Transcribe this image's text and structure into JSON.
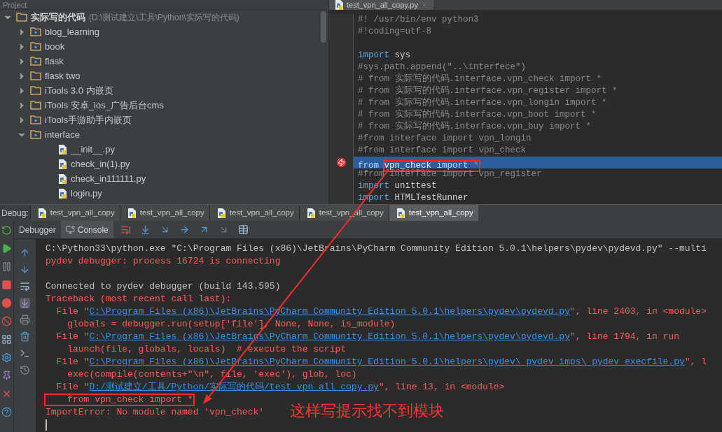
{
  "project_panel": {
    "title": "Project",
    "tree": [
      {
        "kind": "root",
        "name": "实际写的代码",
        "path": "(D:\\测试建立\\工具\\Python\\实际写的代码)",
        "expanded": true,
        "children": [
          {
            "kind": "folder",
            "name": "blog_learning",
            "package": true,
            "expanded": false
          },
          {
            "kind": "folder",
            "name": "book",
            "package": true,
            "expanded": false
          },
          {
            "kind": "folder",
            "name": "flask",
            "package": true,
            "expanded": false
          },
          {
            "kind": "folder",
            "name": "flask two",
            "package": false,
            "expanded": false
          },
          {
            "kind": "folder",
            "name": "iTools 3.0 内嵌页",
            "package": false,
            "expanded": false
          },
          {
            "kind": "folder",
            "name": "iTools 安卓_ios_广告后台cms",
            "package": false,
            "expanded": false
          },
          {
            "kind": "folder",
            "name": "iTools手游助手内嵌页",
            "package": true,
            "expanded": false
          },
          {
            "kind": "folder",
            "name": "interface",
            "package": true,
            "expanded": true,
            "children": [
              {
                "kind": "file",
                "name": "__init__.py"
              },
              {
                "kind": "file",
                "name": "check_in(1).py"
              },
              {
                "kind": "file",
                "name": "check_in111111.py"
              },
              {
                "kind": "file",
                "name": "login.py"
              }
            ]
          }
        ]
      }
    ]
  },
  "editor": {
    "tab": "test_vpn_all_copy.py",
    "lines": [
      {
        "segments": [
          {
            "kind": "comment",
            "text": "#! /usr/bin/env python3"
          }
        ],
        "highlighted": false,
        "breakpoint": false
      },
      {
        "segments": [
          {
            "kind": "comment",
            "text": "#!coding=utf-8"
          }
        ],
        "highlighted": false,
        "breakpoint": false
      },
      {
        "highlighted": false,
        "breakpoint": false
      },
      {
        "segments": [
          {
            "kind": "keyword",
            "text": "import"
          },
          {
            "kind": "plain",
            "text": " sys"
          }
        ],
        "highlighted": false,
        "breakpoint": false
      },
      {
        "segments": [
          {
            "kind": "comment",
            "text": "#sys.path.append(\"..\\interfece\")"
          }
        ],
        "highlighted": false,
        "breakpoint": false
      },
      {
        "segments": [
          {
            "kind": "comment",
            "text": "# from 实际写的代码.interface.vpn_check import *"
          }
        ],
        "highlighted": false,
        "breakpoint": false
      },
      {
        "segments": [
          {
            "kind": "comment",
            "text": "# from 实际写的代码.interface.vpn_register import *"
          }
        ],
        "highlighted": false,
        "breakpoint": false
      },
      {
        "segments": [
          {
            "kind": "comment",
            "text": "# from 实际写的代码.interface.vpn_longin import *"
          }
        ],
        "highlighted": false,
        "breakpoint": false
      },
      {
        "segments": [
          {
            "kind": "comment",
            "text": "# from 实际写的代码.interface.vpn_boot import *"
          }
        ],
        "highlighted": false,
        "breakpoint": false
      },
      {
        "segments": [
          {
            "kind": "comment",
            "text": "# from 实际写的代码.interface.vpn_buy import *"
          }
        ],
        "highlighted": false,
        "breakpoint": false
      },
      {
        "segments": [
          {
            "kind": "comment",
            "text": "#from interface import vpn_longin"
          }
        ],
        "highlighted": false,
        "breakpoint": false
      },
      {
        "segments": [
          {
            "kind": "comment",
            "text": "#from interface import vpn_check"
          }
        ],
        "highlighted": false,
        "breakpoint": false
      },
      {
        "segments": [
          {
            "kind": "keyword",
            "text": "from ",
            "boxed": false
          },
          {
            "kind": "unresolved",
            "text": "vpn_check",
            "boxed": true
          },
          {
            "kind": "keyword",
            "text": " import ",
            "boxed": true
          },
          {
            "kind": "operator",
            "text": "*",
            "boxed": true
          }
        ],
        "highlighted": true,
        "breakpoint": true
      },
      {
        "segments": [
          {
            "kind": "comment",
            "text": "#from interface import vpn_register"
          }
        ],
        "highlighted": false,
        "breakpoint": false
      },
      {
        "segments": [
          {
            "kind": "keyword",
            "text": "import"
          },
          {
            "kind": "plain",
            "text": " unittest"
          }
        ],
        "highlighted": false,
        "breakpoint": false
      },
      {
        "segments": [
          {
            "kind": "keyword",
            "text": "import"
          },
          {
            "kind": "plain",
            "text": " HTMLTestRunner"
          }
        ],
        "highlighted": false,
        "breakpoint": false
      }
    ]
  },
  "debug": {
    "label": "Debug:",
    "tabs": [
      {
        "label": "test_vpn_all_copy",
        "selected": false
      },
      {
        "label": "test_vpn_all_copy",
        "selected": false
      },
      {
        "label": "test_vpn_all_copy",
        "selected": false
      },
      {
        "label": "test_vpn_all_copy",
        "selected": false
      },
      {
        "label": "test_vpn_all_copy",
        "selected": true
      }
    ],
    "subtabs": [
      {
        "label": "Debugger",
        "selected": false
      },
      {
        "label": "Console",
        "selected": true
      }
    ],
    "console": [
      {
        "kind": "text",
        "segments": [
          {
            "kind": "plain",
            "text": "C:\\Python33\\python.exe \"C:\\Program Files (x86)\\JetBrains\\PyCharm Community Edition 5.0.1\\helpers\\pydev\\pydevd.py\" --multi"
          }
        ]
      },
      {
        "kind": "text",
        "segments": [
          {
            "kind": "error",
            "text": "pydev debugger: process 16724 is connecting"
          }
        ]
      },
      {
        "kind": "blank"
      },
      {
        "kind": "text",
        "segments": [
          {
            "kind": "plain",
            "text": "Connected to pydev debugger (build 143.595)"
          }
        ]
      },
      {
        "kind": "text",
        "segments": [
          {
            "kind": "error",
            "text": "Traceback (most recent call last):"
          }
        ]
      },
      {
        "kind": "text",
        "segments": [
          {
            "kind": "error",
            "text": "  File \""
          },
          {
            "kind": "link",
            "text": "C:\\Program Files (x86)\\JetBrains\\PyCharm Community Edition 5.0.1\\helpers\\pydev\\pydevd.py"
          },
          {
            "kind": "error",
            "text": "\", line 2403, in <module>"
          }
        ]
      },
      {
        "kind": "text",
        "segments": [
          {
            "kind": "error",
            "text": "    globals = debugger.run(setup['file'], None, None, is_module)"
          }
        ]
      },
      {
        "kind": "text",
        "segments": [
          {
            "kind": "error",
            "text": "  File \""
          },
          {
            "kind": "link",
            "text": "C:\\Program Files (x86)\\JetBrains\\PyCharm Community Edition 5.0.1\\helpers\\pydev\\pydevd.py"
          },
          {
            "kind": "error",
            "text": "\", line 1794, in run"
          }
        ]
      },
      {
        "kind": "text",
        "segments": [
          {
            "kind": "error",
            "text": "    launch(file, globals, locals)  # execute the script"
          }
        ]
      },
      {
        "kind": "text",
        "segments": [
          {
            "kind": "error",
            "text": "  File \""
          },
          {
            "kind": "link",
            "text": "C:\\Program Files (x86)\\JetBrains\\PyCharm Community Edition 5.0.1\\helpers\\pydev\\_pydev_imps\\_pydev_execfile.py"
          },
          {
            "kind": "error",
            "text": "\", l"
          }
        ]
      },
      {
        "kind": "text",
        "segments": [
          {
            "kind": "error",
            "text": "    exec(compile(contents+\"\\n\", file, 'exec'), glob, loc)"
          }
        ]
      },
      {
        "kind": "text",
        "segments": [
          {
            "kind": "error",
            "text": "  File \""
          },
          {
            "kind": "link",
            "text": "D:/测试建立/工具/Python/实际写的代码/test_vpn_all_copy.py"
          },
          {
            "kind": "error",
            "text": "\", line 13, in <module>"
          }
        ]
      },
      {
        "kind": "text",
        "segments": [
          {
            "kind": "error",
            "text": "    from vpn_check import *",
            "boxed": true
          }
        ]
      },
      {
        "kind": "text",
        "segments": [
          {
            "kind": "error",
            "text": "ImportError: No module named 'vpn_check'"
          }
        ]
      },
      {
        "kind": "cursor"
      }
    ]
  },
  "annotation": {
    "text": "这样写提示找不到模块"
  }
}
